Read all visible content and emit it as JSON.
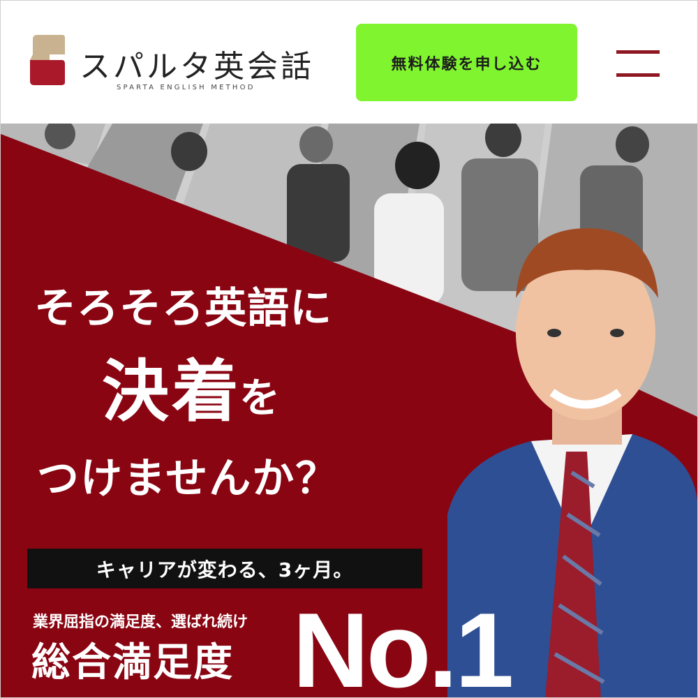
{
  "brand": {
    "name": "スパルタ英会話",
    "tagline": "SPARTA ENGLISH METHOD",
    "colors": {
      "gold": "#c9b28f",
      "red": "#a9192a"
    }
  },
  "header": {
    "cta_label": "無料体験を申し込む",
    "cta_color": "#80f52f",
    "menu_icon": "hamburger-icon",
    "menu_color": "#8e1722"
  },
  "hero": {
    "headline_line1": "そろそろ英語に",
    "headline_emph": "決着",
    "headline_particle": "を",
    "headline_line3": "つけませんか？",
    "tagline": "キャリアが変わる、3ヶ月。",
    "sub": "業界屈指の満足度、選ばれ続け",
    "rating_label": "総合満足度",
    "rating_value": "No.1",
    "bg_color": "#8a0512"
  }
}
